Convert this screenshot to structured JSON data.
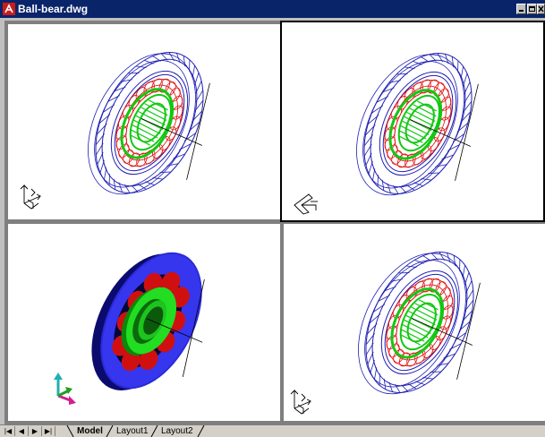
{
  "window": {
    "title": "Ball-bear.dwg"
  },
  "tabs": [
    "Model",
    "Layout1",
    "Layout2"
  ],
  "colors": {
    "title_bg": "#0a246a",
    "wire_blue": "#1e1eb4",
    "wire_red": "#e01010",
    "wire_green": "#12c812"
  },
  "nav": {
    "first": "|◀",
    "prev": "◀",
    "next": "▶",
    "last": "▶|"
  }
}
